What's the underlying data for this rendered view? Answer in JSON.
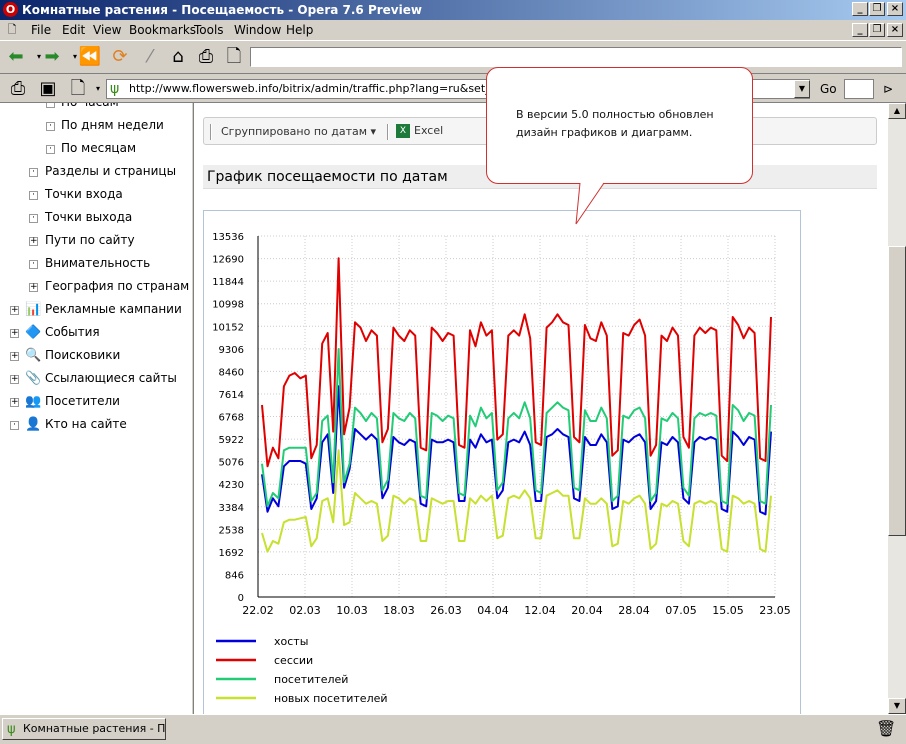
{
  "window": {
    "title": "Комнатные растения - Посещаемость - Opera 7.6 Preview",
    "icon": "opera-icon"
  },
  "menu": {
    "items": [
      "File",
      "Edit",
      "View",
      "Bookmarks",
      "Tools",
      "Window",
      "Help"
    ]
  },
  "address_bar": {
    "url": "http://www.flowersweb.info/bitrix/admin/traffic.php?lang=ru&set_default",
    "go_label": "Go"
  },
  "tree": {
    "items": [
      {
        "label": "По часам",
        "level": 2
      },
      {
        "label": "По дням недели",
        "level": 2
      },
      {
        "label": "По месяцам",
        "level": 2
      },
      {
        "label": "Разделы и страницы",
        "level": 1
      },
      {
        "label": "Точки входа",
        "level": 1
      },
      {
        "label": "Точки выхода",
        "level": 1
      },
      {
        "label": "Пути по сайту",
        "level": 1
      },
      {
        "label": "Внимательность",
        "level": 1
      },
      {
        "label": "География по странам",
        "level": 1
      },
      {
        "label": "Рекламные кампании",
        "level": 0
      },
      {
        "label": "События",
        "level": 0
      },
      {
        "label": "Поисковики",
        "level": 0
      },
      {
        "label": "Ссылающиеся сайты",
        "level": 0
      },
      {
        "label": "Посетители",
        "level": 0
      },
      {
        "label": "Кто на сайте",
        "level": 0
      }
    ]
  },
  "panel_toolbar": {
    "group_label": "Сгруппировано по датам",
    "excel_label": "Excel"
  },
  "section": {
    "title": "График посещаемости по датам"
  },
  "callout": {
    "text": "В версии 5.0 полностью обновлен дизайн графиков и диаграмм."
  },
  "taskbar": {
    "task_label": "Комнатные растения - П..."
  },
  "chart_data": {
    "type": "line",
    "title": "",
    "xlabel": "",
    "ylabel": "",
    "x_ticks": [
      "22.02",
      "02.03",
      "10.03",
      "18.03",
      "26.03",
      "04.04",
      "12.04",
      "20.04",
      "28.04",
      "07.05",
      "15.05",
      "23.05"
    ],
    "y_ticks": [
      0,
      846,
      1692,
      2538,
      3384,
      4230,
      5076,
      5922,
      6768,
      7614,
      8460,
      9306,
      10152,
      10998,
      11844,
      12690,
      13536
    ],
    "ylim": [
      0,
      13536
    ],
    "x_range": [
      "22.02",
      "23.05"
    ],
    "grid": true,
    "legend_position": "bottom-left",
    "series": [
      {
        "name": "хосты",
        "color": "#0000dd",
        "values": [
          4600,
          3200,
          3700,
          3400,
          4900,
          5100,
          5100,
          5100,
          5000,
          3300,
          3700,
          5800,
          6100,
          3900,
          7900,
          4100,
          4800,
          6300,
          6100,
          5900,
          6100,
          5900,
          3700,
          4100,
          6000,
          5800,
          5700,
          5900,
          5800,
          3500,
          3400,
          5900,
          5800,
          5800,
          5900,
          5800,
          3600,
          3600,
          5900,
          5600,
          6100,
          5800,
          5900,
          3700,
          4000,
          5800,
          5900,
          5800,
          6200,
          5700,
          3600,
          3600,
          6000,
          6100,
          6300,
          6100,
          6000,
          3700,
          3600,
          6000,
          5700,
          5700,
          6100,
          5800,
          3300,
          3400,
          5900,
          5800,
          6000,
          6100,
          5800,
          3300,
          3600,
          5800,
          5700,
          6000,
          5800,
          3700,
          3500,
          5800,
          6000,
          5900,
          6000,
          5900,
          3300,
          3200,
          6200,
          6000,
          5700,
          6000,
          5900,
          3200,
          3100,
          6200
        ]
      },
      {
        "name": "сессии",
        "color": "#e00000",
        "values": [
          7200,
          4900,
          5600,
          5200,
          7900,
          8300,
          8400,
          8200,
          8300,
          5200,
          5700,
          9500,
          9900,
          6200,
          12700,
          6100,
          7100,
          10300,
          10100,
          9600,
          10000,
          9800,
          5800,
          6300,
          10100,
          9800,
          9600,
          10000,
          9800,
          5600,
          5500,
          10100,
          9900,
          9600,
          9900,
          9800,
          5700,
          5600,
          10000,
          9400,
          10300,
          9800,
          10000,
          5900,
          6100,
          9800,
          10000,
          9800,
          10600,
          9700,
          5800,
          5700,
          10100,
          10300,
          10600,
          10300,
          10200,
          6000,
          5800,
          10200,
          9700,
          9600,
          10300,
          9800,
          5300,
          5500,
          9900,
          9800,
          10200,
          10400,
          9800,
          5300,
          5700,
          9800,
          9600,
          10100,
          9800,
          6000,
          5600,
          9800,
          10100,
          9900,
          10100,
          10000,
          5300,
          5100,
          10500,
          10200,
          9700,
          10100,
          9900,
          5200,
          5100,
          10500
        ]
      },
      {
        "name": "посетителей",
        "color": "#22cc77",
        "values": [
          5000,
          3400,
          3900,
          3700,
          5500,
          5600,
          5600,
          5600,
          5600,
          3600,
          3900,
          6600,
          6800,
          4300,
          9300,
          4300,
          5000,
          7100,
          6900,
          6600,
          6900,
          6700,
          4000,
          4400,
          6900,
          6700,
          6600,
          6900,
          6700,
          3800,
          3700,
          6900,
          6800,
          6600,
          6800,
          6700,
          3900,
          3800,
          6800,
          6400,
          7100,
          6700,
          6900,
          4000,
          4300,
          6700,
          6900,
          6700,
          7300,
          6700,
          4000,
          3900,
          6900,
          7100,
          7300,
          7100,
          7000,
          4100,
          4000,
          7000,
          6600,
          6600,
          7100,
          6700,
          3600,
          3800,
          6800,
          6700,
          7000,
          7100,
          6700,
          3600,
          3900,
          6700,
          6600,
          6900,
          6700,
          4100,
          3800,
          6700,
          6900,
          6800,
          6900,
          6800,
          3600,
          3500,
          7200,
          7000,
          6600,
          6900,
          6800,
          3600,
          3500,
          7200
        ]
      },
      {
        "name": "новых посетителей",
        "color": "#c8e030",
        "values": [
          2400,
          1700,
          2100,
          2000,
          2800,
          2900,
          2900,
          2950,
          3000,
          1900,
          2200,
          3600,
          3700,
          2800,
          5500,
          2700,
          2800,
          3900,
          3700,
          3500,
          3600,
          3500,
          2100,
          2300,
          3800,
          3700,
          3500,
          3700,
          3600,
          2100,
          2100,
          3700,
          3600,
          3500,
          3600,
          3600,
          2100,
          2100,
          3700,
          3500,
          3800,
          3600,
          3800,
          2200,
          2300,
          3700,
          3800,
          3700,
          4000,
          3700,
          2200,
          2200,
          3800,
          3900,
          4000,
          3800,
          3800,
          2200,
          2200,
          3700,
          3500,
          3500,
          3700,
          3500,
          1900,
          2000,
          3600,
          3500,
          3700,
          3800,
          3500,
          1800,
          2000,
          3500,
          3400,
          3600,
          3500,
          2100,
          1900,
          3500,
          3600,
          3500,
          3600,
          3500,
          1800,
          1700,
          3800,
          3700,
          3500,
          3600,
          3500,
          1800,
          1700,
          3800
        ]
      }
    ]
  }
}
